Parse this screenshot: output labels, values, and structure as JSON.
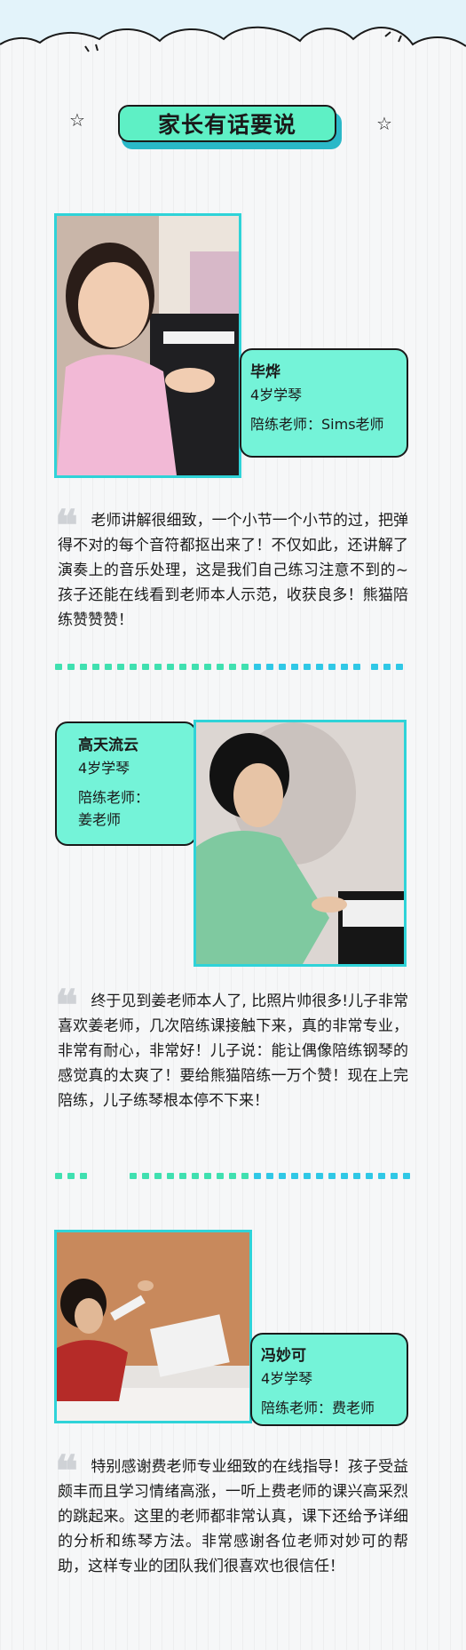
{
  "page_title": "家长有话要说",
  "colors": {
    "mint": "#74f3d8",
    "teal": "#2fd3d8",
    "green_dot": "#40e0b0",
    "cyan_dot": "#30c8e6"
  },
  "testimonials": [
    {
      "student": "毕烨",
      "age": "4岁学琴",
      "teacher": "陪练老师：Sims老师",
      "quote": "老师讲解很细致，一个小节一个小节的过，把弹得不对的每个音符都抠出来了！不仅如此，还讲解了演奏上的音乐处理，这是我们自己练习注意不到的~孩子还能在线看到老师本人示范，收获良多！熊猫陪练赞赞赞！"
    },
    {
      "student": "高天流云",
      "age": "4岁学琴",
      "teacher_label": "陪练老师：",
      "teacher_name": "姜老师",
      "quote": "终于见到姜老师本人了, 比照片帅很多!儿子非常喜欢姜老师，几次陪练课接触下来，真的非常专业，非常有耐心，非常好！儿子说：能让偶像陪练钢琴的感觉真的太爽了！要给熊猫陪练一万个赞！现在上完陪练，儿子练琴根本停不下来！"
    },
    {
      "student": "冯妙可",
      "age": "4岁学琴",
      "teacher": "陪练老师：费老师",
      "quote": "特别感谢费老师专业细致的在线指导！孩子受益颇丰而且学习情绪高涨，一听上费老师的课兴高采烈的跳起来。这里的老师都非常认真，课下还给予详细的分析和练琴方法。非常感谢各位老师对妙可的帮助，这样专业的团队我们很喜欢也很信任！"
    }
  ]
}
